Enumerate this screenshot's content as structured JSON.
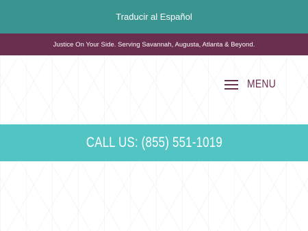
{
  "translate": {
    "label": "Traducir al Español"
  },
  "tagline": {
    "text": "Justice On Your Side. Serving Savannah, Augusta, Atlanta & Beyond."
  },
  "header": {
    "menu_label": "MENU",
    "menu_icon": "hamburger-icon"
  },
  "call_bar": {
    "label": "CALL US:",
    "phone": "(855) 551-1019"
  },
  "colors": {
    "translate_bar": "#3a9490",
    "tagline_bar": "#6a2e4e",
    "menu_accent": "#6a2e4e",
    "call_bar": "#52c4c4",
    "text_light": "#ffffff"
  }
}
